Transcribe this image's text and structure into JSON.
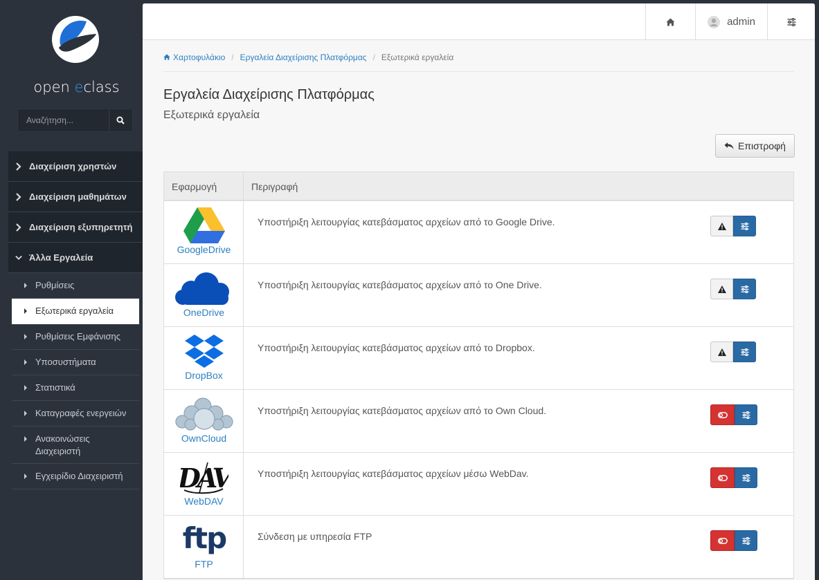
{
  "brand": {
    "name_pre": "open ",
    "name_e": "e",
    "name_post": "class"
  },
  "search": {
    "placeholder": "Αναζήτηση..."
  },
  "menu": {
    "groups": [
      {
        "label": "Διαχείριση χρηστών"
      },
      {
        "label": "Διαχείριση μαθημάτων"
      },
      {
        "label": "Διαχείριση εξυπηρετητή"
      },
      {
        "label": "Άλλα Εργαλεία"
      }
    ],
    "items": [
      {
        "label": "Ρυθμίσεις"
      },
      {
        "label": "Εξωτερικά εργαλεία"
      },
      {
        "label": "Ρυθμίσεις Εμφάνισης"
      },
      {
        "label": "Υποσυστήματα"
      },
      {
        "label": "Στατιστικά"
      },
      {
        "label": "Καταγραφές ενεργειών"
      },
      {
        "label": "Ανακοινώσεις Διαχειριστή"
      },
      {
        "label": "Εγχειρίδιο Διαχειριστή"
      }
    ]
  },
  "topbar": {
    "user": "admin"
  },
  "breadcrumb": {
    "home": "Χαρτοφυλάκιο",
    "section": "Εργαλεία Διαχείρισης Πλατφόρμας",
    "current": "Εξωτερικά εργαλεία",
    "sep": "/"
  },
  "page": {
    "title": "Εργαλεία Διαχείρισης Πλατφόρμας",
    "subtitle": "Εξωτερικά εργαλεία",
    "back_label": "Επιστροφή"
  },
  "table": {
    "headers": {
      "app": "Εφαρμογή",
      "desc": "Περιγραφή"
    },
    "rows": [
      {
        "name": "GoogleDrive",
        "icon": "google-drive-icon",
        "desc": "Υποστήριξη λειτουργίας κατεβάσματος αρχείων από το Google Drive.",
        "state": "warning"
      },
      {
        "name": "OneDrive",
        "icon": "onedrive-icon",
        "desc": "Υποστήριξη λειτουργίας κατεβάσματος αρχείων από το One Drive.",
        "state": "warning"
      },
      {
        "name": "DropBox",
        "icon": "dropbox-icon",
        "desc": "Υποστήριξη λειτουργίας κατεβάσματος αρχείων από το Dropbox.",
        "state": "warning"
      },
      {
        "name": "OwnCloud",
        "icon": "owncloud-icon",
        "desc": "Υποστήριξη λειτουργίας κατεβάσματος αρχείων από το Own Cloud.",
        "state": "disabled"
      },
      {
        "name": "WebDAV",
        "icon": "webdav-icon",
        "desc": "Υποστήριξη λειτουργίας κατεβάσματος αρχείων μέσω WebDav.",
        "state": "disabled"
      },
      {
        "name": "FTP",
        "icon": "ftp-icon",
        "desc": "Σύνδεση με υπηρεσία FTP",
        "state": "disabled"
      }
    ]
  },
  "colors": {
    "sidebar": "#2b323c",
    "link": "#2d7fc0",
    "danger": "#d43331",
    "primary": "#2a6aa4"
  }
}
